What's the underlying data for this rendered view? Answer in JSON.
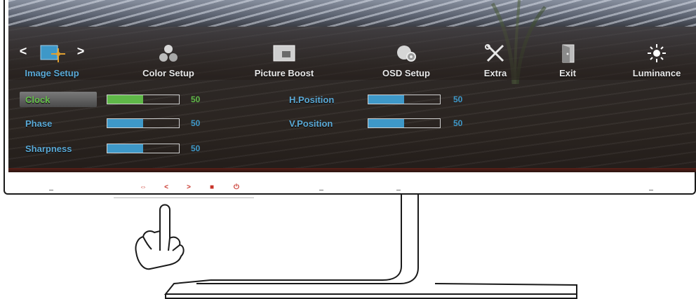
{
  "menu": {
    "items": [
      {
        "id": "image-setup",
        "label": "Image Setup",
        "icon": "image-setup-icon",
        "active": true
      },
      {
        "id": "color-setup",
        "label": "Color Setup",
        "icon": "color-setup-icon",
        "active": false
      },
      {
        "id": "picture-boost",
        "label": "Picture Boost",
        "icon": "picture-boost-icon",
        "active": false
      },
      {
        "id": "osd-setup",
        "label": "OSD Setup",
        "icon": "osd-setup-icon",
        "active": false
      },
      {
        "id": "extra",
        "label": "Extra",
        "icon": "tools-icon",
        "active": false
      },
      {
        "id": "exit",
        "label": "Exit",
        "icon": "exit-door-icon",
        "active": false
      },
      {
        "id": "luminance",
        "label": "Luminance",
        "icon": "brightness-icon",
        "active": false
      }
    ],
    "left_arrow": "<",
    "right_arrow": ">"
  },
  "settings": {
    "left": [
      {
        "label": "Clock",
        "value": "50",
        "level": 0.5,
        "selected": true
      },
      {
        "label": "Phase",
        "value": "50",
        "level": 0.5,
        "selected": false
      },
      {
        "label": "Sharpness",
        "value": "50",
        "level": 0.5,
        "selected": false
      }
    ],
    "right": [
      {
        "label": "H.Position",
        "value": "50",
        "level": 0.5,
        "selected": false
      },
      {
        "label": "V.Position",
        "value": "50",
        "level": 0.5,
        "selected": false
      }
    ]
  },
  "panel_buttons": [
    {
      "name": "source-button",
      "symbol": "⇔"
    },
    {
      "name": "left-button",
      "symbol": "<"
    },
    {
      "name": "right-button",
      "symbol": ">"
    },
    {
      "name": "menu-button",
      "symbol": "■"
    },
    {
      "name": "power-button",
      "symbol": "⏻"
    }
  ],
  "colors": {
    "accent_blue": "#3e98c8",
    "accent_green": "#5fb848",
    "label_blue": "#5aa9d6",
    "panel_red": "#c8342a"
  }
}
